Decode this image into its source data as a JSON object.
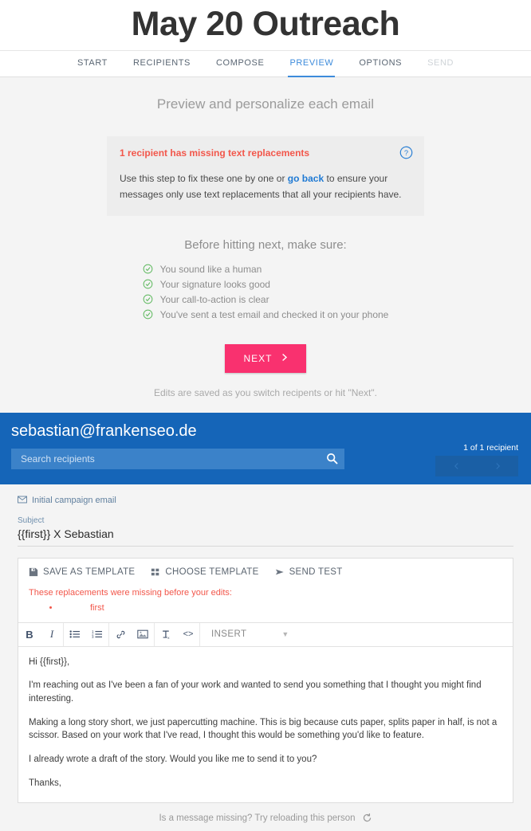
{
  "header": {
    "title": "May 20 Outreach",
    "tabs": [
      {
        "label": "START",
        "state": "normal"
      },
      {
        "label": "RECIPIENTS",
        "state": "normal"
      },
      {
        "label": "COMPOSE",
        "state": "normal"
      },
      {
        "label": "PREVIEW",
        "state": "active"
      },
      {
        "label": "OPTIONS",
        "state": "normal"
      },
      {
        "label": "SEND",
        "state": "disabled"
      }
    ]
  },
  "step": {
    "heading": "Preview and personalize each email",
    "alert": {
      "title": "1 recipient has missing text replacements",
      "body_before": "Use this step to fix these one by one or ",
      "link": "go back",
      "body_after": " to ensure your messages only use text replacements that all your recipients have.",
      "help_icon": "help-circle-icon"
    },
    "checklist_title": "Before hitting next, make sure:",
    "checklist": [
      "You sound like a human",
      "Your signature looks good",
      "Your call-to-action is clear",
      "You've sent a test email and checked it on your phone"
    ],
    "next_label": "NEXT",
    "next_icon": "chevron-right-icon",
    "save_note": "Edits are saved as you switch recipents or hit \"Next\"."
  },
  "recipient": {
    "email": "sebastian@frankenseo.de",
    "count": "1 of 1 recipient",
    "search_placeholder": "Search recipients",
    "search_value": "",
    "search_icon": "search-icon",
    "prev_icon": "chevron-left-icon",
    "next_icon": "chevron-right-icon"
  },
  "message": {
    "kind_label": "Initial campaign email",
    "kind_icon": "mail-icon",
    "subject_label": "Subject",
    "subject_value": "{{first}} X Sebastian",
    "template_actions": [
      {
        "label": "SAVE AS TEMPLATE",
        "icon": "save-icon"
      },
      {
        "label": "CHOOSE TEMPLATE",
        "icon": "grid-icon"
      },
      {
        "label": "SEND TEST",
        "icon": "send-icon"
      }
    ],
    "missing_note": "These replacements were missing before your edits:",
    "missing_items": [
      "first"
    ],
    "format_buttons": [
      {
        "name": "bold",
        "glyph": "B"
      },
      {
        "name": "italic",
        "glyph": "I"
      },
      {
        "name": "bulleted-list",
        "glyph": ""
      },
      {
        "name": "numbered-list",
        "glyph": ""
      },
      {
        "name": "link",
        "glyph": ""
      },
      {
        "name": "image",
        "glyph": ""
      },
      {
        "name": "clear-formatting",
        "glyph": ""
      },
      {
        "name": "code",
        "glyph": "<>"
      }
    ],
    "insert_label": "INSERT",
    "body_paragraphs": [
      "Hi {{first}},",
      "I'm reaching out as I've been a fan of your work and wanted to send you something that I thought you might find interesting.",
      "Making a long story short, we just papercutting machine. This is big because cuts paper, splits paper in half, is not a scissor. Based on your work that I've read, I thought this would be something you'd like to feature.",
      "I already wrote a draft of the story.  Would you like me to send it to you?",
      "Thanks,"
    ],
    "reload_note": "Is a message missing? Try reloading this person",
    "reload_icon": "refresh-icon"
  },
  "colors": {
    "brand_blue": "#1565b8",
    "accent_pink": "#f9316f",
    "link_blue": "#1f7ad4",
    "warning_red": "#f2574b",
    "success_green": "#5cb85c",
    "page_bg": "#f4f4f4"
  }
}
